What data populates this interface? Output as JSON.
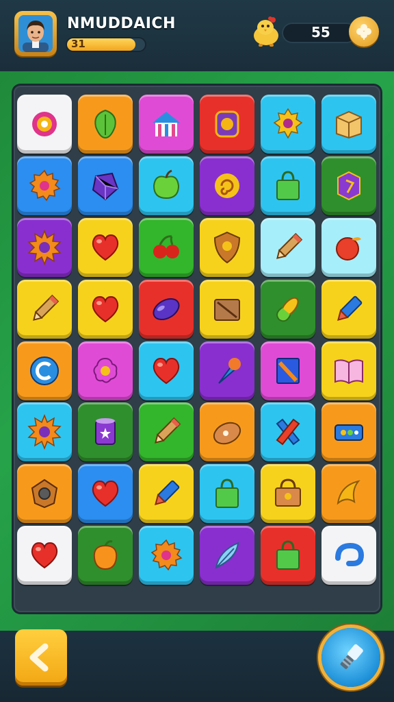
{
  "player": {
    "name": "NMUDDAICH",
    "level": "31",
    "xp_progress": 0.88,
    "avatar_icon": "player-avatar"
  },
  "currency": {
    "count": "55",
    "mascot_icon": "chick-mascot-icon",
    "add_icon": "clover-icon"
  },
  "controls": {
    "back_icon": "chevron-left-icon",
    "hint_icon": "hint-tool-icon"
  },
  "colors": {
    "white": "#f4f4f6",
    "orange": "#f79a1c",
    "magenta": "#e04bd6",
    "red": "#e8302a",
    "cyan": "#2ec4f0",
    "blue": "#2b8ef0",
    "purple": "#8a2fcf",
    "green": "#33b52c",
    "darkgreen": "#2f8f2c",
    "yellow": "#f7d21c",
    "lightcyan": "#a6eefa"
  },
  "board": {
    "rows": 8,
    "cols": 6,
    "tiles": [
      [
        {
          "bg": "white",
          "icon": "donut-icon"
        },
        {
          "bg": "orange",
          "icon": "leaf-icon"
        },
        {
          "bg": "magenta",
          "icon": "house-icon"
        },
        {
          "bg": "red",
          "icon": "jar-icon"
        },
        {
          "bg": "cyan",
          "icon": "badge-icon"
        },
        {
          "bg": "cyan",
          "icon": "box-icon"
        }
      ],
      [
        {
          "bg": "blue",
          "icon": "gear-icon"
        },
        {
          "bg": "blue",
          "icon": "gem-icon"
        },
        {
          "bg": "cyan",
          "icon": "apple-icon"
        },
        {
          "bg": "purple",
          "icon": "swirl-icon"
        },
        {
          "bg": "cyan",
          "icon": "bag-icon"
        },
        {
          "bg": "darkgreen",
          "icon": "cube-icon"
        }
      ],
      [
        {
          "bg": "purple",
          "icon": "sun-icon"
        },
        {
          "bg": "yellow",
          "icon": "heart-icon"
        },
        {
          "bg": "green",
          "icon": "cherries-icon"
        },
        {
          "bg": "yellow",
          "icon": "shield-icon"
        },
        {
          "bg": "lightcyan",
          "icon": "pencil-icon"
        },
        {
          "bg": "lightcyan",
          "icon": "fruit-icon"
        }
      ],
      [
        {
          "bg": "yellow",
          "icon": "pencil-icon"
        },
        {
          "bg": "yellow",
          "icon": "heart-icon"
        },
        {
          "bg": "red",
          "icon": "oval-gem-icon"
        },
        {
          "bg": "yellow",
          "icon": "frame-icon"
        },
        {
          "bg": "darkgreen",
          "icon": "corn-icon"
        },
        {
          "bg": "yellow",
          "icon": "crayon-icon"
        }
      ],
      [
        {
          "bg": "orange",
          "icon": "c-swirl-icon"
        },
        {
          "bg": "magenta",
          "icon": "flower-icon"
        },
        {
          "bg": "cyan",
          "icon": "heart-icon"
        },
        {
          "bg": "purple",
          "icon": "cone-icon"
        },
        {
          "bg": "magenta",
          "icon": "book-icon"
        },
        {
          "bg": "yellow",
          "icon": "open-book-icon"
        }
      ],
      [
        {
          "bg": "cyan",
          "icon": "sun-icon"
        },
        {
          "bg": "darkgreen",
          "icon": "can-icon"
        },
        {
          "bg": "green",
          "icon": "pencil-icon"
        },
        {
          "bg": "orange",
          "icon": "bread-icon"
        },
        {
          "bg": "cyan",
          "icon": "cross-icon"
        },
        {
          "bg": "orange",
          "icon": "tray-icon"
        }
      ],
      [
        {
          "bg": "orange",
          "icon": "nut-icon"
        },
        {
          "bg": "blue",
          "icon": "heart-icon"
        },
        {
          "bg": "yellow",
          "icon": "crayon-icon"
        },
        {
          "bg": "cyan",
          "icon": "bag-icon"
        },
        {
          "bg": "yellow",
          "icon": "basket-icon"
        },
        {
          "bg": "orange",
          "icon": "banana-icon"
        }
      ],
      [
        {
          "bg": "white",
          "icon": "heart-icon"
        },
        {
          "bg": "darkgreen",
          "icon": "peach-icon"
        },
        {
          "bg": "cyan",
          "icon": "gear-icon"
        },
        {
          "bg": "purple",
          "icon": "feather-icon"
        },
        {
          "bg": "red",
          "icon": "bag-icon"
        },
        {
          "bg": "white",
          "icon": "hook-icon"
        }
      ]
    ]
  }
}
